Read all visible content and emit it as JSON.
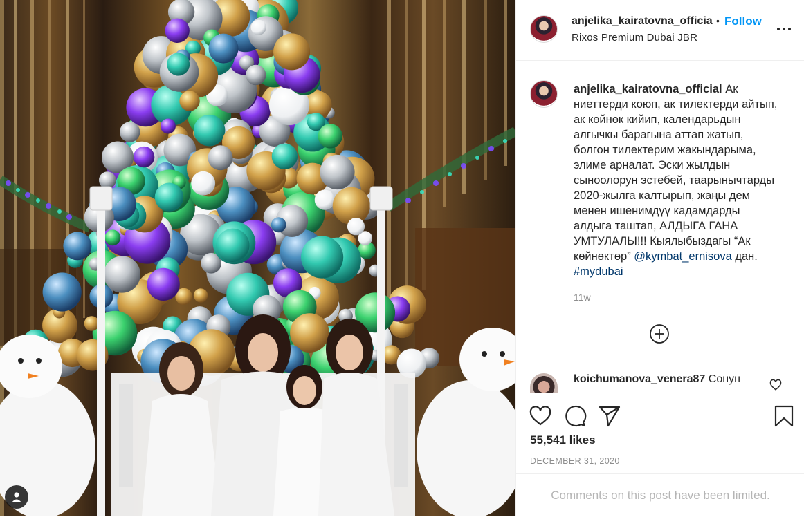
{
  "post": {
    "username": "anjelika_kairatovna_official",
    "dot": "•",
    "follow_label": "Follow",
    "location": "Rixos Premium Dubai JBR",
    "more_icon": "more-options-icon",
    "photo_description_icon": "user-tag-icon"
  },
  "caption": {
    "username": "anjelika_kairatovna_official",
    "text_1": " Ак ниеттерди коюп, ак тилектерди айтып, ак көйнөк кийип, календарьдын алгычкы барагына аттап жатып, болгон тилектерим жакындарыма, элиме арналат. Эски жылдын сыноолорун эстебей, таарынычтарды 2020-жылга калтырып, жаңы дем менен ишенимдүү кадамдарды алдыга таштап, АЛДЫГА ГАНА УМТУЛАЛЫ!!! Кыялыбыздагы “Ак көйнөктөр” ",
    "mention": "@kymbat_ernisova",
    "text_2": " дан. ",
    "hashtag": "#mydubai",
    "time": "11w"
  },
  "load_more_icon": "plus-circle-icon",
  "comment": {
    "username": "koichumanova_venera87",
    "text": " Сонун"
  },
  "actions": {
    "like_icon": "heart-icon",
    "comment_icon": "comment-icon",
    "share_icon": "paper-plane-icon",
    "save_icon": "bookmark-icon"
  },
  "likes": "55,541 likes",
  "date": "DECEMBER 31, 2020",
  "comments_limited": "Comments on this post have been limited.",
  "colors": {
    "link": "#0095f6",
    "mention": "#00376b",
    "muted": "#8e8e8e",
    "text": "#262626"
  }
}
